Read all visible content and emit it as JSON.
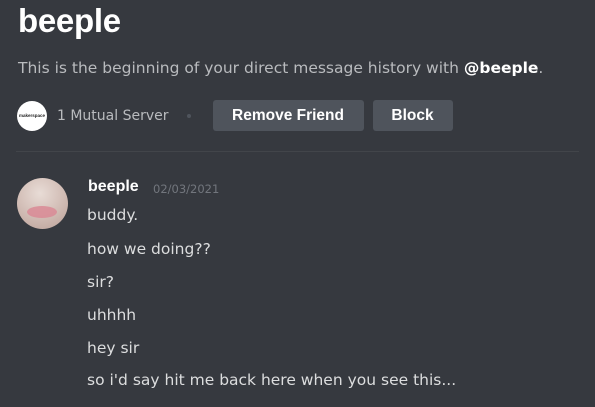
{
  "header": {
    "title": "beeple",
    "subtitle_prefix": "This is the beginning of your direct message history with ",
    "subtitle_user": "@beeple",
    "subtitle_suffix": "."
  },
  "profile_actions": {
    "server_icon_text": "makerspace",
    "mutual_servers": "1 Mutual Server",
    "remove_friend_label": "Remove Friend",
    "block_label": "Block"
  },
  "message_group": {
    "author": "beeple",
    "timestamp": "02/03/2021",
    "messages": [
      "buddy.",
      "how we doing??",
      "sir?",
      "uhhhh",
      "hey sir",
      "so i'd say hit me back here when you see this..."
    ]
  },
  "colors": {
    "background": "#36393f",
    "button": "#4f545c",
    "text_primary": "#ffffff",
    "text_muted": "#b9bbbe",
    "message_text": "#dcddde"
  }
}
